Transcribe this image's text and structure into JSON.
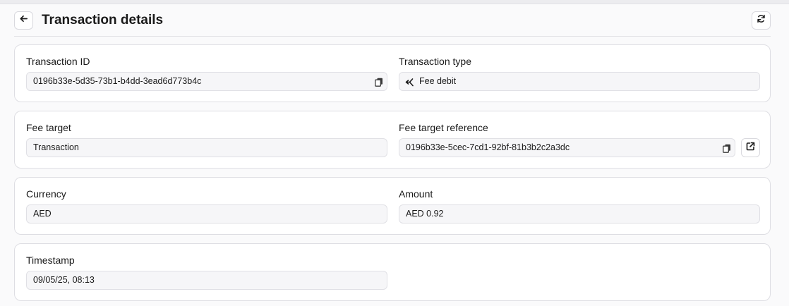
{
  "header": {
    "title": "Transaction details"
  },
  "icons": {
    "back": "arrow-left-icon",
    "refresh": "refresh-icon",
    "copy": "copy-icon",
    "fee_type": "fee-debit-icon",
    "external": "external-link-icon"
  },
  "sections": {
    "ids": {
      "transaction_id_label": "Transaction ID",
      "transaction_id_value": "0196b33e-5d35-73b1-b4dd-3ead6d773b4c",
      "transaction_type_label": "Transaction type",
      "transaction_type_value": "Fee debit"
    },
    "fee": {
      "fee_target_label": "Fee target",
      "fee_target_value": "Transaction",
      "fee_target_ref_label": "Fee target reference",
      "fee_target_ref_value": "0196b33e-5cec-7cd1-92bf-81b3b2c2a3dc"
    },
    "money": {
      "currency_label": "Currency",
      "currency_value": "AED",
      "amount_label": "Amount",
      "amount_value": "AED 0.92"
    },
    "time": {
      "timestamp_label": "Timestamp",
      "timestamp_value": "09/05/25, 08:13"
    }
  }
}
